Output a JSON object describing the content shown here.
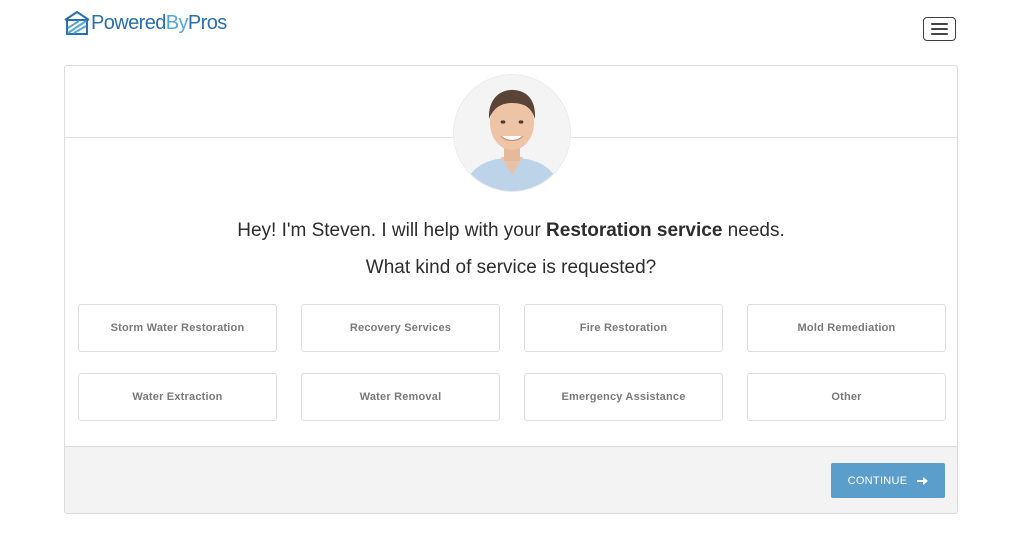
{
  "brand": {
    "part1": "Powered",
    "part2": "By",
    "part3": "Pros",
    "colors": {
      "dark": "#2a6fae",
      "light": "#54a7d8"
    }
  },
  "header": {
    "menu_icon": "hamburger-icon"
  },
  "assistant": {
    "avatar": "person-avatar"
  },
  "intro": {
    "text_before": "Hey! I'm Steven. I will help with your ",
    "highlight": "Restoration service",
    "text_after": " needs."
  },
  "question": "What kind of service is requested?",
  "options": [
    "Storm Water Restoration",
    "Recovery Services",
    "Fire Restoration",
    "Mold Remediation",
    "Water Extraction",
    "Water Removal",
    "Emergency Assistance",
    "Other"
  ],
  "footer": {
    "continue_label": "CONTINUE",
    "continue_icon": "arrow-right-icon",
    "accent": "#5b9ecb"
  }
}
